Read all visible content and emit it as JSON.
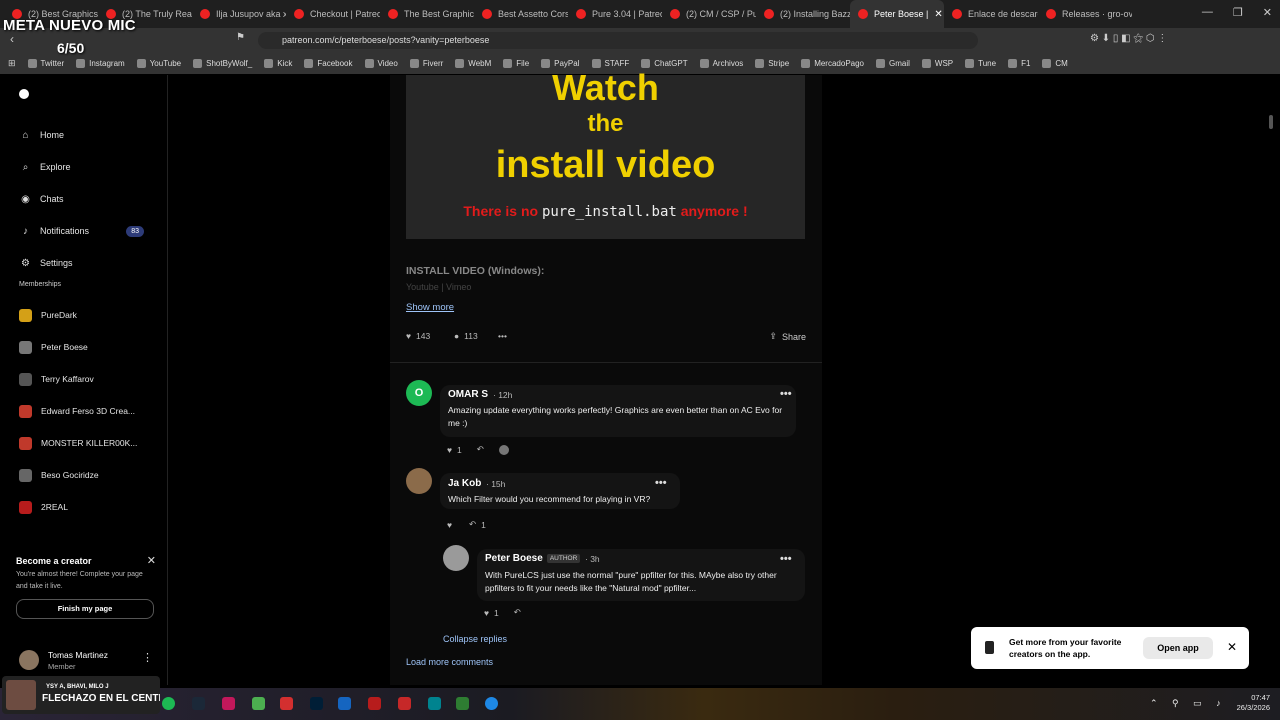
{
  "overlay": {
    "title": "META NUEVO MIC",
    "count": "6/50"
  },
  "tabs": [
    {
      "label": "(2) Best Graphics"
    },
    {
      "label": "(2) The Truly Real"
    },
    {
      "label": "Ilja Jusupov aka x"
    },
    {
      "label": "Checkout | Patreo"
    },
    {
      "label": "The Best Graphic"
    },
    {
      "label": "Best Assetto Cors"
    },
    {
      "label": "Pure 3.04 | Patreo"
    },
    {
      "label": "(2) CM / CSP / Pu"
    },
    {
      "label": "(2) Installing Bazz"
    },
    {
      "label": "Peter Boese |"
    },
    {
      "label": "Enlace de descarg"
    },
    {
      "label": "Releases · gro-ove"
    }
  ],
  "address": {
    "url": "patreon.com/c/peterboese/posts?vanity=peterboese"
  },
  "bookmarks": [
    "Twitter",
    "Instagram",
    "YouTube",
    "ShotByWolf_",
    "Kick",
    "Facebook",
    "Video",
    "Fiverr",
    "WebM",
    "File",
    "PayPal",
    "STAFF",
    "ChatGPT",
    "Archivos",
    "Stripe",
    "MercadoPago",
    "Gmail",
    "WSP",
    "Tune",
    "F1",
    "CM"
  ],
  "nav": [
    {
      "label": "Home",
      "icon": "home-icon"
    },
    {
      "label": "Explore",
      "icon": "search-icon"
    },
    {
      "label": "Chats",
      "icon": "chat-icon"
    },
    {
      "label": "Notifications",
      "icon": "bell-icon",
      "badge": "83"
    },
    {
      "label": "Settings",
      "icon": "gear-icon"
    }
  ],
  "memberships_title": "Memberships",
  "memberships": [
    {
      "label": "PureDark",
      "color": "#d4a017"
    },
    {
      "label": "Peter Boese",
      "color": "#777777"
    },
    {
      "label": "Terry Kaffarov",
      "color": "#555555"
    },
    {
      "label": "Edward Ferso 3D Crea...",
      "color": "#c0392b"
    },
    {
      "label": "MONSTER KILLER00K...",
      "color": "#c0392b"
    },
    {
      "label": "Beso Gociridze",
      "color": "#666666"
    },
    {
      "label": "2REAL",
      "color": "#b71c1c"
    }
  ],
  "creator_card": {
    "title": "Become a creator",
    "text": "You're almost there! Complete your page and take it live.",
    "button": "Finish my page"
  },
  "user": {
    "name": "Tomas Martinez",
    "role": "Member"
  },
  "post": {
    "image_watch": "Watch",
    "image_the": "the",
    "image_install": "install video",
    "image_note_pre": "There is no",
    "image_note_code": "pure_install.bat",
    "image_note_post": "anymore !",
    "install_label": "INSTALL VIDEO (Windows):",
    "faded_text": "Youtube | Vimeo",
    "show_more": "Show more",
    "likes": "143",
    "comments": "113",
    "share": "Share"
  },
  "comments": [
    {
      "name": "OMAR S",
      "time": "12h",
      "text": "Amazing update everything works perfectly! Graphics are even better than on AC Evo for me :)",
      "likes": "1",
      "avatar_letter": "O"
    },
    {
      "name": "Ja Kob",
      "time": "15h",
      "text": "Which Filter would you recommend for playing in VR?",
      "replies": "1"
    },
    {
      "name": "Peter Boese",
      "badge": "AUTHOR",
      "time": "3h",
      "text": "With PureLCS just use the normal \"pure\" ppfilter for this. MAybe also try other ppfilters to fit your needs like the \"Natural mod\" ppfilter...",
      "likes": "1"
    }
  ],
  "collapse_replies": "Collapse replies",
  "load_more": "Load more comments",
  "app_banner": {
    "text": "Get more from your favorite creators on the app.",
    "button": "Open app"
  },
  "taskbar": {
    "live_line1": "YSY A, BHAVI, MILO J",
    "live_line2": "FLECHAZO EN EL CENTRO",
    "time": "07:47",
    "date": "26/3/2026"
  }
}
